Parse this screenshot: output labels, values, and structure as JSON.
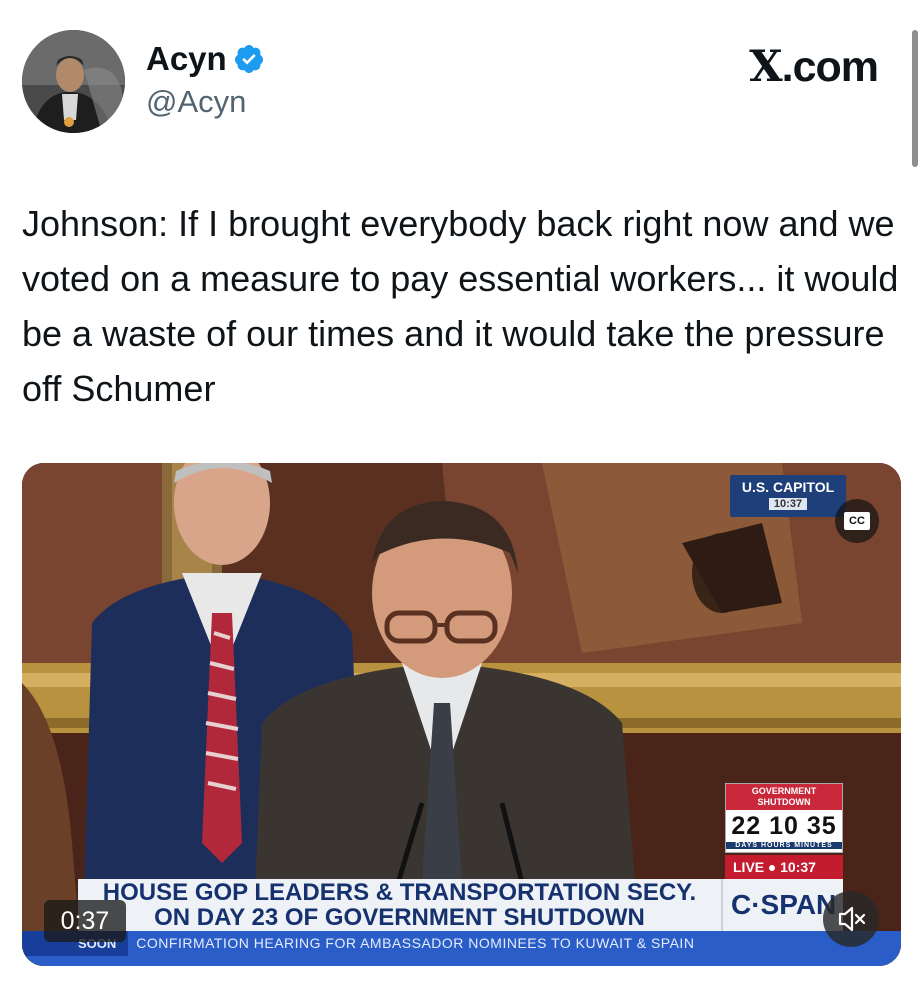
{
  "author": {
    "display_name": "Acyn",
    "handle": "@Acyn",
    "verified": true
  },
  "brand": {
    "prefix": "X",
    "suffix": ".com"
  },
  "tweet": {
    "text": "Johnson: If I brought everybody back right now and we voted on a measure to pay essential workers... it would be a waste of our times and it would take the pressure off Schumer"
  },
  "video": {
    "duration": "0:37",
    "location_bug": "U.S. CAPITOL",
    "location_time": "10:37",
    "cc_label": "CC",
    "shutdown_label": "GOVERNMENT SHUTDOWN",
    "shutdown_count": "22 10 35",
    "shutdown_units": "DAYS  HOURS  MINUTES",
    "live_label": "LIVE",
    "live_time": "10:37",
    "chyron_line1": "HOUSE GOP LEADERS & TRANSPORTATION SECY.",
    "chyron_line2": "ON DAY 23 OF GOVERNMENT SHUTDOWN",
    "network": "C·SPAN",
    "ticker_tag": "SOON",
    "ticker_text": "CONFIRMATION HEARING FOR AMBASSADOR NOMINEES TO KUWAIT & SPAIN"
  },
  "icons": {
    "verified": "verified-badge-icon",
    "mute": "speaker-muted-icon",
    "cc": "closed-captions-icon"
  },
  "colors": {
    "verified_blue": "#1d9bf0",
    "handle_gray": "#536471",
    "text": "#0f1419",
    "live_red": "#c41b2f",
    "cspan_navy": "#15326e"
  }
}
